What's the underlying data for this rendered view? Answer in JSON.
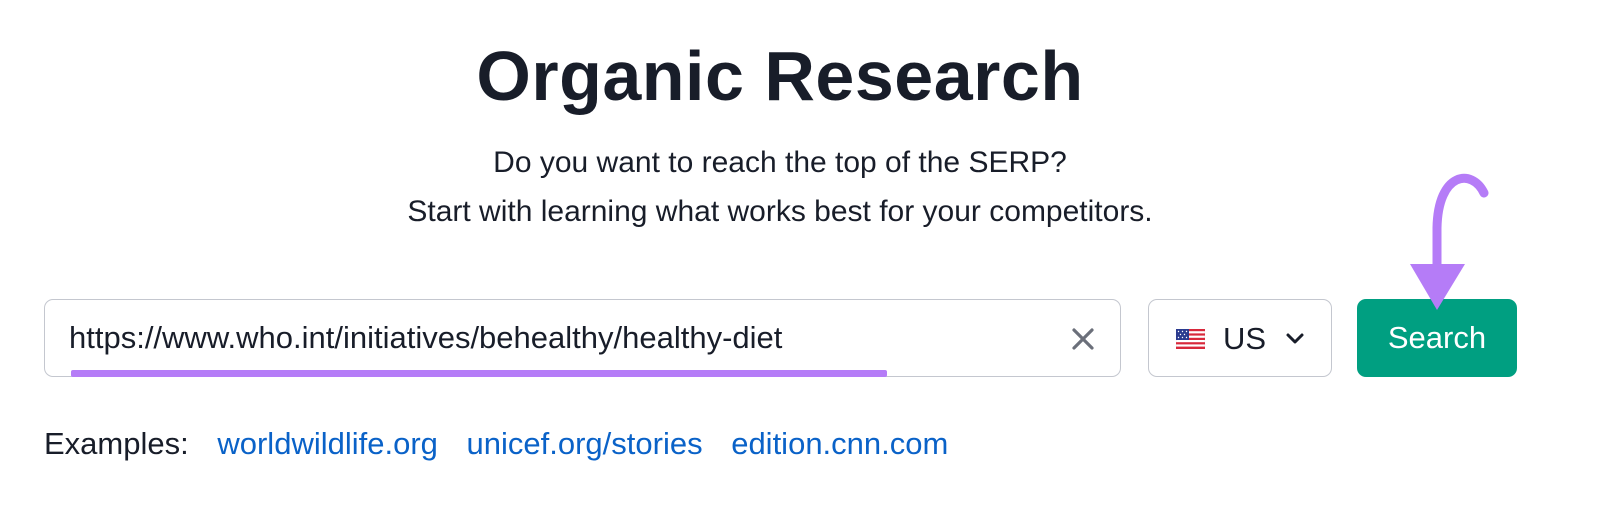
{
  "header": {
    "title": "Organic Research",
    "subtitle_line1": "Do you want to reach the top of the SERP?",
    "subtitle_line2": "Start with learning what works best for your competitors."
  },
  "search": {
    "url_value": "https://www.who.int/initiatives/behealthy/healthy-diet",
    "clear_icon": "close-icon",
    "database_country": "US",
    "database_flag": "us-flag-icon",
    "search_label": "Search"
  },
  "examples": {
    "label": "Examples:",
    "links": [
      "worldwildlife.org",
      "unicef.org/stories",
      "edition.cnn.com"
    ]
  },
  "colors": {
    "accent_green": "#009f81",
    "highlight_purple": "#b57cf7",
    "link_blue": "#0a62c8",
    "text_dark": "#181d29"
  }
}
